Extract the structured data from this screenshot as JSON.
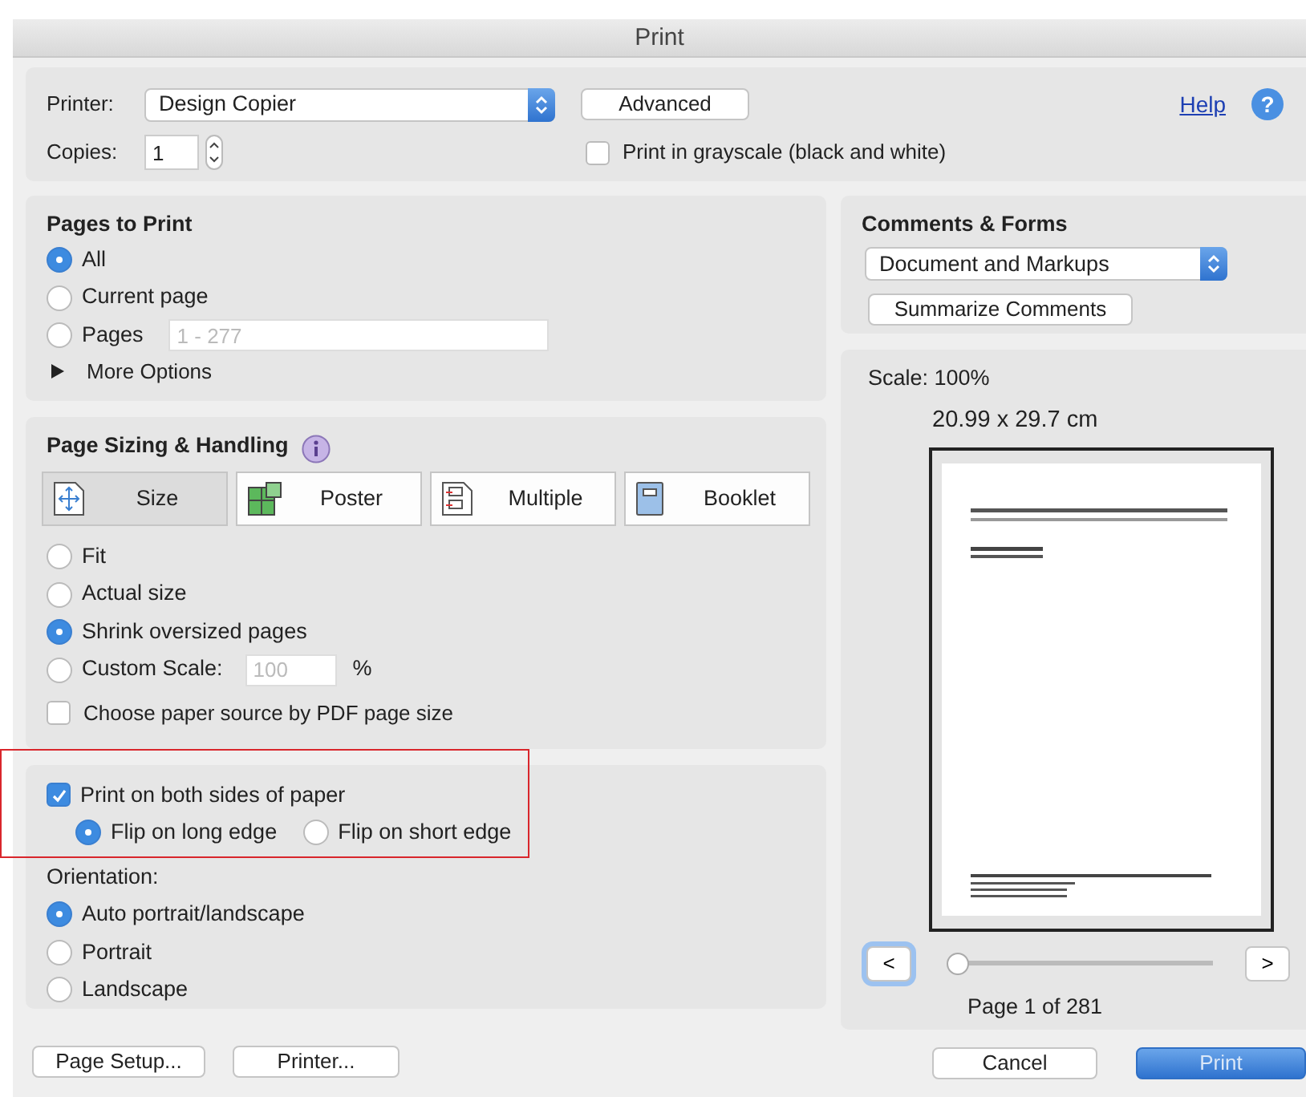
{
  "window": {
    "title": "Print"
  },
  "printer": {
    "label": "Printer:",
    "value": "Design Copier"
  },
  "advanced_button": "Advanced",
  "help_link": "Help",
  "help_icon": "?",
  "copies": {
    "label": "Copies:",
    "value": "1"
  },
  "grayscale": {
    "label": "Print in grayscale (black and white)",
    "checked": false
  },
  "pages_to_print": {
    "title": "Pages to Print",
    "options": [
      {
        "label": "All",
        "selected": true
      },
      {
        "label": "Current page",
        "selected": false
      },
      {
        "label": "Pages",
        "selected": false,
        "placeholder": "1 - 277"
      }
    ],
    "more_options": "More Options"
  },
  "page_sizing": {
    "title": "Page Sizing & Handling",
    "modes": [
      {
        "kind": "size",
        "label": "Size",
        "selected": true
      },
      {
        "kind": "poster",
        "label": "Poster",
        "selected": false
      },
      {
        "kind": "multiple",
        "label": "Multiple",
        "selected": false
      },
      {
        "kind": "booklet",
        "label": "Booklet",
        "selected": false
      }
    ],
    "options": [
      {
        "label": "Fit",
        "selected": false
      },
      {
        "label": "Actual size",
        "selected": false
      },
      {
        "label": "Shrink oversized pages",
        "selected": true
      },
      {
        "label": "Custom Scale:",
        "selected": false,
        "placeholder": "100",
        "unit": "%"
      }
    ],
    "paper_source": {
      "label": "Choose paper source by PDF page size",
      "checked": false
    }
  },
  "duplex": {
    "highlighted": true,
    "label": "Print on both sides of paper",
    "checked": true,
    "flip": [
      {
        "label": "Flip on long edge",
        "selected": true
      },
      {
        "label": "Flip on short edge",
        "selected": false
      }
    ]
  },
  "orientation": {
    "label": "Orientation:",
    "options": [
      {
        "label": "Auto portrait/landscape",
        "selected": true
      },
      {
        "label": "Portrait",
        "selected": false
      },
      {
        "label": "Landscape",
        "selected": false
      }
    ]
  },
  "comments_forms": {
    "title": "Comments & Forms",
    "value": "Document and Markups",
    "summarize_button": "Summarize Comments"
  },
  "preview": {
    "scale": "Scale: 100%",
    "size": "20.99 x 29.7 cm",
    "prev": {
      "label": "<",
      "focused": true
    },
    "next": {
      "label": ">",
      "focused": false
    },
    "slider": {
      "level": 0
    },
    "page": "Page 1 of 281"
  },
  "buttons": {
    "page_setup": "Page Setup...",
    "printer": "Printer...",
    "cancel": "Cancel",
    "print": "Print"
  }
}
